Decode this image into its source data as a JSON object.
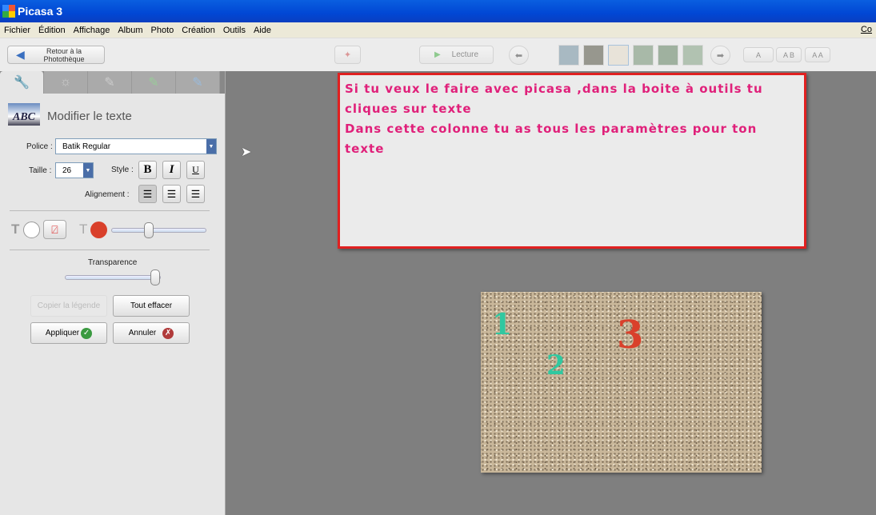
{
  "window": {
    "title": "Picasa 3"
  },
  "menu": [
    "Fichier",
    "Édition",
    "Affichage",
    "Album",
    "Photo",
    "Création",
    "Outils",
    "Aide"
  ],
  "menu_cut": "Co",
  "toolbar": {
    "back_label_1": "Retour à la",
    "back_label_2": "Photothèque",
    "play_label": "Lecture",
    "caption_modes": [
      "A",
      "A B",
      "A A"
    ]
  },
  "panel": {
    "title": "Modifier le texte",
    "font_label": "Police :",
    "font_value": "Batik Regular",
    "size_label": "Taille :",
    "size_value": "26",
    "style_label": "Style :",
    "style_buttons": [
      "B",
      "I",
      "U"
    ],
    "align_label": "Alignement :",
    "transparency_label": "Transparence",
    "transparency_value": 0.95,
    "outline_value": 0.4,
    "text_color": "#d9402b",
    "buttons": {
      "copy": "Copier la légende",
      "clear": "Tout effacer",
      "apply": "Appliquer",
      "cancel": "Annuler"
    }
  },
  "annotation": {
    "lines": [
      "Si tu veux le faire avec picasa ,dans la boite à outils tu",
      "cliques sur texte",
      "Dans cette colonne tu as tous les paramètres pour ton texte"
    ],
    "color": "#e0207a",
    "border": "#e02020"
  },
  "photo": {
    "labels": [
      {
        "text": "1",
        "color": "#30c8a0"
      },
      {
        "text": "2",
        "color": "#30c8a0"
      },
      {
        "text": "3",
        "color": "#d9402b"
      }
    ]
  }
}
